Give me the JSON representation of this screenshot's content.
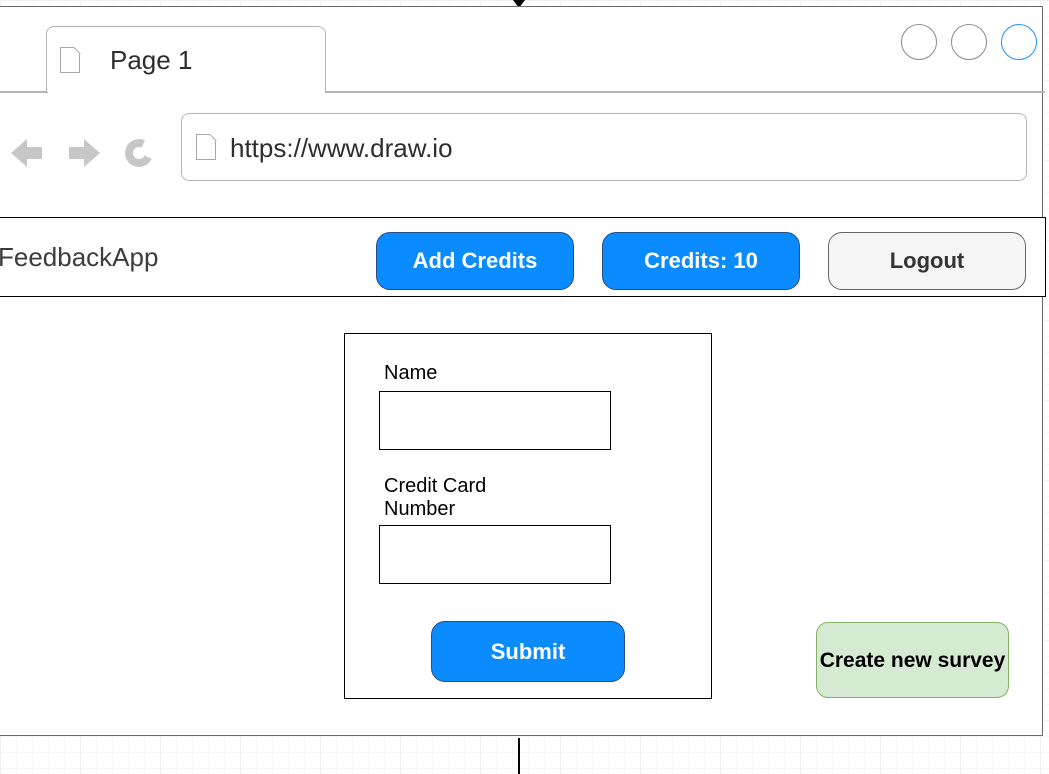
{
  "browser": {
    "tab_label": "Page 1",
    "url": "https://www.draw.io"
  },
  "header": {
    "brand": "FeedbackApp",
    "add_credits_label": "Add Credits",
    "credits_label": "Credits: 10",
    "logout_label": "Logout"
  },
  "form": {
    "name_label": "Name",
    "card_label": "Credit Card Number",
    "name_value": "",
    "card_value": "",
    "submit_label": "Submit"
  },
  "create_survey_label": "Create new survey",
  "colors": {
    "primary_button": "#0a8bff",
    "create_button_fill": "#d6ead3",
    "create_button_border": "#82b366",
    "active_window_control": "#1e90ff"
  },
  "icons": [
    "page-icon",
    "back-arrow-icon",
    "forward-arrow-icon",
    "refresh-icon"
  ]
}
